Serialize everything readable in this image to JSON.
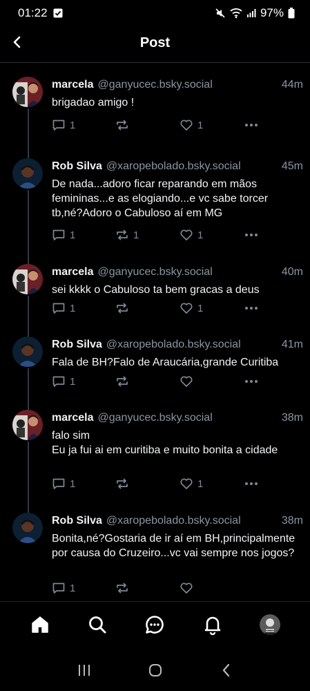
{
  "status_bar": {
    "time": "01:22",
    "battery": "97%"
  },
  "header": {
    "title": "Post"
  },
  "colors": {
    "background": "#000000",
    "text_primary": "#f1f3f5",
    "text_secondary": "#8a96a3",
    "icon_muted": "#7e8a97",
    "thread_line": "#2e3a48"
  },
  "posts": [
    {
      "author": "marcela",
      "handle": "@ganyucec.bsky.social",
      "time": "44m",
      "text": "brigadao amigo !",
      "reply_count": "1",
      "repost_count": "",
      "like_count": "1"
    },
    {
      "author": "Rob Silva",
      "handle": "@xaropebolado.bsky.social",
      "time": "45m",
      "text": "De nada...adoro ficar reparando em mãos femininas...e as elogiando...e vc sabe torcer tb,né?Adoro o Cabuloso aí em MG",
      "reply_count": "1",
      "repost_count": "1",
      "like_count": "1"
    },
    {
      "author": "marcela",
      "handle": "@ganyucec.bsky.social",
      "time": "40m",
      "text": "sei kkkk o Cabuloso ta bem gracas a deus",
      "reply_count": "1",
      "repost_count": "",
      "like_count": "1"
    },
    {
      "author": "Rob Silva",
      "handle": "@xaropebolado.bsky.social",
      "time": "41m",
      "text": "Fala de BH?Falo de Araucária,grande Curitiba",
      "reply_count": "1",
      "repost_count": "",
      "like_count": ""
    },
    {
      "author": "marcela",
      "handle": "@ganyucec.bsky.social",
      "time": "38m",
      "text": "falo sim\nEu ja fui ai em curitiba e muito bonita a cidade",
      "reply_count": "1",
      "repost_count": "",
      "like_count": "1"
    },
    {
      "author": "Rob Silva",
      "handle": "@xaropebolado.bsky.social",
      "time": "38m",
      "text": "Bonita,né?Gostaria de ir aí em BH,principalmente por causa do Cruzeiro...vc vai sempre nos jogos?",
      "reply_count": "1",
      "repost_count": "",
      "like_count": ""
    }
  ],
  "bottom_nav": {
    "items": [
      "home-icon",
      "search-icon",
      "chat-icon",
      "bell-icon",
      "profile-avatar"
    ]
  },
  "system_nav": {
    "items": [
      "recents-icon",
      "home-circle-icon",
      "back-chevron-icon"
    ]
  }
}
